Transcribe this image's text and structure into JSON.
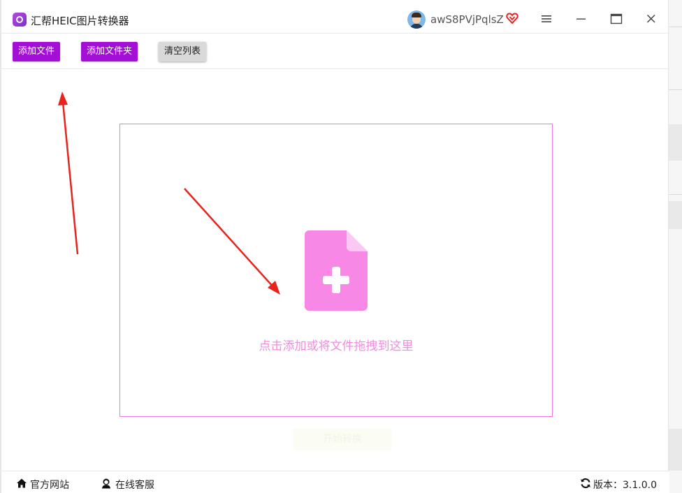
{
  "window": {
    "title": "汇帮HEIC图片转换器",
    "username": "awS8PVjPqlsZ"
  },
  "toolbar": {
    "add_file": "添加文件",
    "add_folder": "添加文件夹",
    "clear_list": "清空列表"
  },
  "dropzone": {
    "hint": "点击添加或将文件拖拽到这里",
    "icon": "file-plus-icon"
  },
  "ghost_button": {
    "label": "开始转换"
  },
  "statusbar": {
    "official_site": "官方网站",
    "online_service": "在线客服",
    "version": "版本：3.1.0.0"
  },
  "colors": {
    "accent": "#a40fd6",
    "dropzone_border": "#ee78e0",
    "icon_pink": "#f788e6",
    "arrow_red": "#e8231c"
  }
}
